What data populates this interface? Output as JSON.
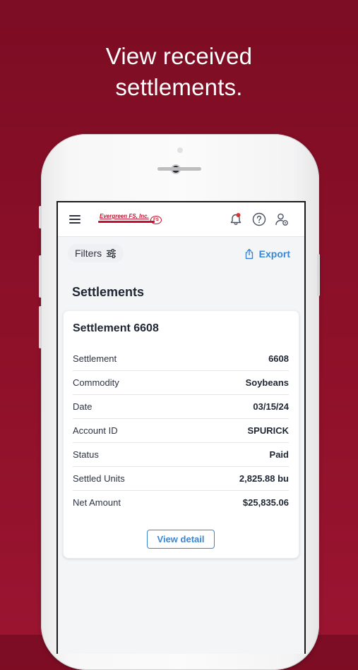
{
  "promo": {
    "headline_line1": "View received",
    "headline_line2": "settlements."
  },
  "topbar": {
    "logo_text": "Evergreen FS, Inc.",
    "logo_mark": "FS",
    "icons": [
      "menu-icon",
      "bell-icon",
      "help-icon",
      "user-settings-icon"
    ],
    "notification_dot_color": "#e03131"
  },
  "toolbar": {
    "filters_label": "Filters",
    "export_label": "Export"
  },
  "page": {
    "title": "Settlements"
  },
  "settlement_card": {
    "title": "Settlement 6608",
    "rows": [
      {
        "label": "Settlement",
        "value": "6608"
      },
      {
        "label": "Commodity",
        "value": "Soybeans"
      },
      {
        "label": "Date",
        "value": "03/15/24"
      },
      {
        "label": "Account ID",
        "value": "SPURICK"
      },
      {
        "label": "Status",
        "value": "Paid"
      },
      {
        "label": "Settled Units",
        "value": "2,825.88 bu"
      },
      {
        "label": "Net Amount",
        "value": "$25,835.06"
      }
    ],
    "detail_button_label": "View detail"
  },
  "colors": {
    "background": "#8e1029",
    "accent": "#3a86d1",
    "brand": "#c8102e"
  }
}
